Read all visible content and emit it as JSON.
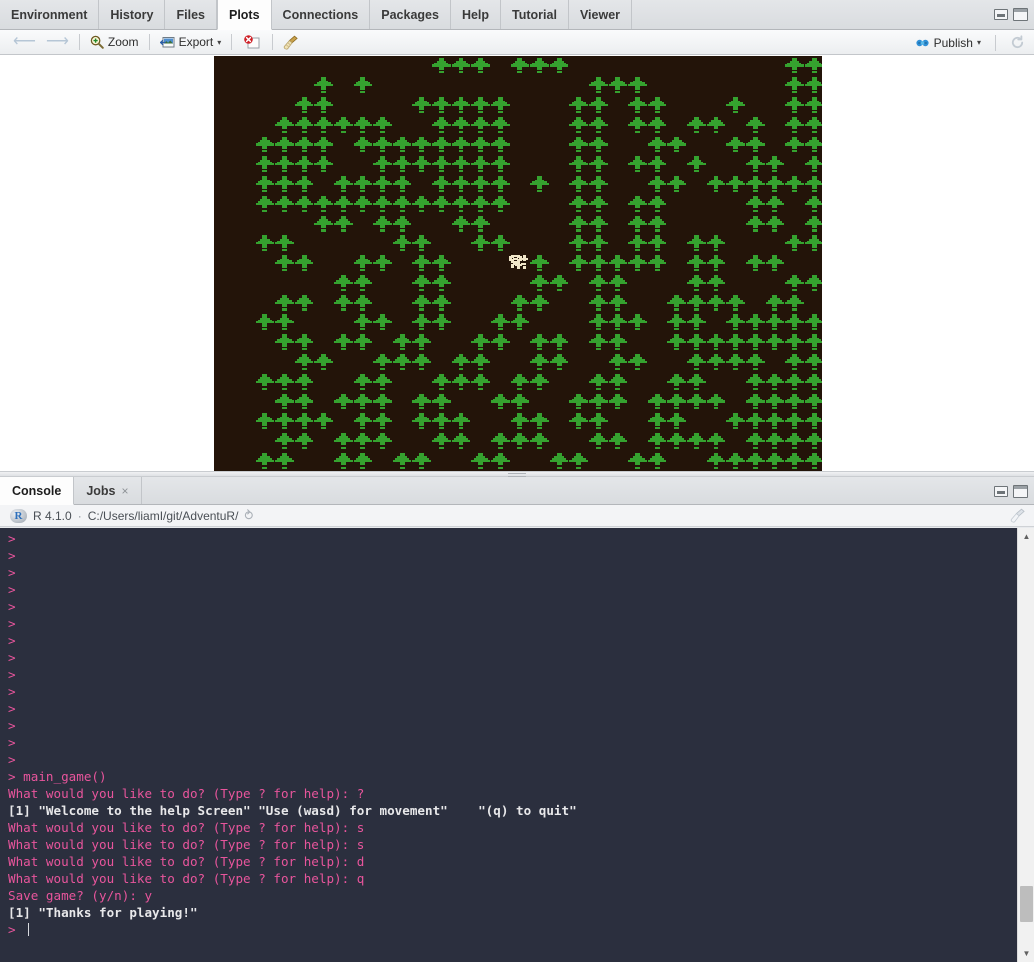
{
  "plots_pane": {
    "tabs": [
      {
        "label": "Environment",
        "active": false
      },
      {
        "label": "History",
        "active": false
      },
      {
        "label": "Files",
        "active": false
      },
      {
        "label": "Plots",
        "active": true
      },
      {
        "label": "Connections",
        "active": false
      },
      {
        "label": "Packages",
        "active": false
      },
      {
        "label": "Help",
        "active": false
      },
      {
        "label": "Tutorial",
        "active": false
      },
      {
        "label": "Viewer",
        "active": false
      }
    ],
    "toolbar": {
      "back_icon": "arrow-left-icon",
      "forward_icon": "arrow-right-icon",
      "zoom_label": "Zoom",
      "zoom_icon": "magnifier-plus-icon",
      "export_label": "Export",
      "export_icon": "export-image-icon",
      "export_caret": "▾",
      "remove_icon": "remove-plot-icon",
      "clear_icon": "broom-icon",
      "publish_label": "Publish",
      "publish_icon": "publish-icon",
      "publish_caret": "▾",
      "refresh_icon": "refresh-icon"
    },
    "window_controls": {
      "minimize": "minimize-icon",
      "maximize": "maximize-icon"
    }
  },
  "plot": {
    "background_color": "#231409",
    "tree_color": "#35a22f",
    "tree_dark_color": "#2d8a28",
    "player_color": "#f0e6c8",
    "alt_text": "AdventuR pixel-art forest map with player character"
  },
  "console_pane": {
    "tabs": [
      {
        "label": "Console",
        "active": true,
        "closable": false
      },
      {
        "label": "Jobs",
        "active": false,
        "closable": true,
        "close_icon": "close-icon"
      }
    ],
    "close_glyph": "×",
    "info": {
      "r_logo": "R",
      "version": "R 4.1.0",
      "separator": "·",
      "working_directory": "C:/Users/liamI/git/AdventuR/",
      "path_arrow_icon": "open-directory-icon",
      "clear_console_icon": "broom-icon"
    },
    "window_controls": {
      "minimize": "minimize-icon",
      "maximize": "maximize-icon"
    },
    "scrollbar": {
      "up_arrow": "▲",
      "down_arrow": "▼"
    },
    "lines": [
      {
        "type": "prompt",
        "text": "> "
      },
      {
        "type": "prompt",
        "text": "> "
      },
      {
        "type": "prompt",
        "text": "> "
      },
      {
        "type": "prompt",
        "text": "> "
      },
      {
        "type": "prompt",
        "text": "> "
      },
      {
        "type": "prompt",
        "text": "> "
      },
      {
        "type": "prompt",
        "text": "> "
      },
      {
        "type": "prompt",
        "text": "> "
      },
      {
        "type": "prompt",
        "text": "> "
      },
      {
        "type": "prompt",
        "text": "> "
      },
      {
        "type": "prompt",
        "text": "> "
      },
      {
        "type": "prompt",
        "text": "> "
      },
      {
        "type": "prompt",
        "text": "> "
      },
      {
        "type": "prompt",
        "text": "> "
      },
      {
        "type": "prompt",
        "text": "> main_game()"
      },
      {
        "type": "prompt",
        "text": "What would you like to do? (Type ? for help): ?"
      },
      {
        "type": "output",
        "text": "[1] \"Welcome to the help Screen\" \"Use (wasd) for movement\"    \"(q) to quit\""
      },
      {
        "type": "prompt",
        "text": "What would you like to do? (Type ? for help): s"
      },
      {
        "type": "prompt",
        "text": "What would you like to do? (Type ? for help): s"
      },
      {
        "type": "prompt",
        "text": "What would you like to do? (Type ? for help): d"
      },
      {
        "type": "prompt",
        "text": "What would you like to do? (Type ? for help): q"
      },
      {
        "type": "prompt",
        "text": "Save game? (y/n): y"
      },
      {
        "type": "output",
        "text": "[1] \"Thanks for playing!\""
      },
      {
        "type": "input-line",
        "text": "> "
      }
    ]
  },
  "colors": {
    "console_bg": "#2b2f3e",
    "console_prompt": "#e8559c",
    "console_output": "#e8e8ea",
    "plot_bg": "#231409",
    "tree_green": "#35a22f",
    "player_cream": "#f0e6c8"
  }
}
